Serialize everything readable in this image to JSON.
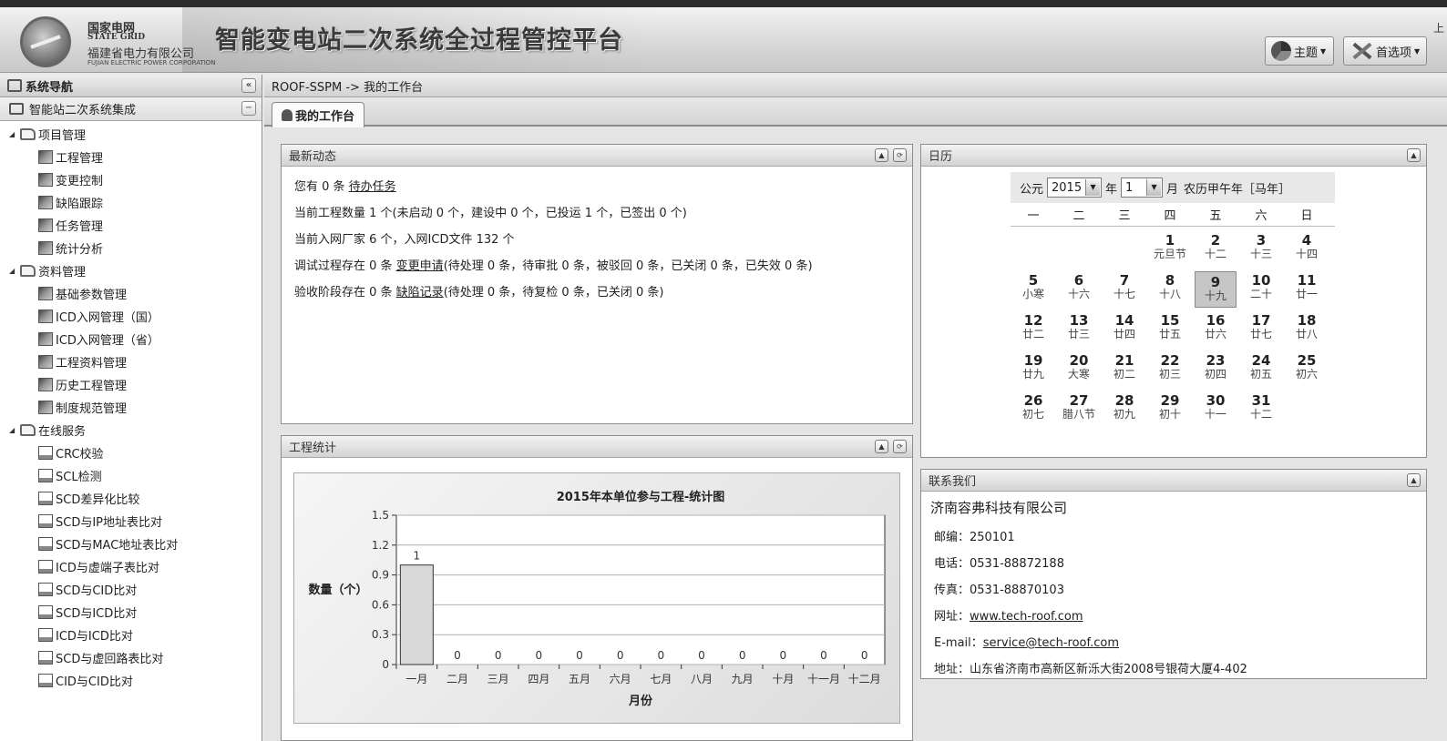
{
  "header": {
    "org_name": "国家电网",
    "org_name_en": "STATE GRID",
    "org_sub": "福建省电力有限公司",
    "org_sub_en": "FUJIAN ELECTRIC POWER CORPORATION",
    "app_title": "智能变电站二次系统全过程管控平台",
    "theme_label": "主题",
    "prefs_label": "首选项",
    "corner_text": "上"
  },
  "sidebar": {
    "title": "系统导航",
    "section": "智能站二次系统集成",
    "groups": [
      {
        "label": "项目管理",
        "items": [
          "工程管理",
          "变更控制",
          "缺陷跟踪",
          "任务管理",
          "统计分析"
        ]
      },
      {
        "label": "资料管理",
        "items": [
          "基础参数管理",
          "ICD入网管理（国）",
          "ICD入网管理（省）",
          "工程资料管理",
          "历史工程管理",
          "制度规范管理"
        ]
      },
      {
        "label": "在线服务",
        "items": [
          "CRC校验",
          "SCL检测",
          "SCD差异化比较",
          "SCD与IP地址表比对",
          "SCD与MAC地址表比对",
          "ICD与虚端子表比对",
          "SCD与CID比对",
          "SCD与ICD比对",
          "ICD与ICD比对",
          "SCD与虚回路表比对",
          "CID与CID比对"
        ]
      }
    ]
  },
  "main": {
    "breadcrumb": "ROOF-SSPM -> 我的工作台",
    "tab_label": "我的工作台"
  },
  "news": {
    "title": "最新动态",
    "line1": {
      "pre": "您有 0 条 ",
      "link": "待办任务",
      "post": ""
    },
    "line2": "当前工程数量 1 个(未启动 0 个，建设中 0 个，已投运 1 个，已签出 0 个)",
    "line3": "当前入网厂家 6 个，入网ICD文件 132 个",
    "line4": {
      "pre": "调试过程存在 0 条 ",
      "link": "变更申请",
      "post": "(待处理 0 条，待审批 0 条，被驳回 0 条，已关闭 0 条，已失效 0 条)"
    },
    "line5": {
      "pre": "验收阶段存在 0 条 ",
      "link": "缺陷记录",
      "post": "(待处理 0 条，待复检 0 条，已关闭 0 条)"
    }
  },
  "stats": {
    "title": "工程统计"
  },
  "chart_data": {
    "type": "bar",
    "title": "2015年本单位参与工程-统计图",
    "xlabel": "月份",
    "ylabel": "数量（个）",
    "categories": [
      "一月",
      "二月",
      "三月",
      "四月",
      "五月",
      "六月",
      "七月",
      "八月",
      "九月",
      "十月",
      "十一月",
      "十二月"
    ],
    "values": [
      1,
      0,
      0,
      0,
      0,
      0,
      0,
      0,
      0,
      0,
      0,
      0
    ],
    "ylim": [
      0,
      1.5
    ],
    "yticks": [
      "0",
      "0.3",
      "0.6",
      "0.9",
      "1.2",
      "1.5"
    ],
    "grid": true,
    "data_labels": true
  },
  "calendar": {
    "title": "日历",
    "era_label": "公元",
    "year": "2015",
    "year_unit": "年",
    "month": "1",
    "month_unit": "月",
    "lunar_label": "农历甲午年［马年］",
    "weekdays": [
      "一",
      "二",
      "三",
      "四",
      "五",
      "六",
      "日"
    ],
    "start_offset": 3,
    "today": 9,
    "days": [
      {
        "d": "1",
        "l": "元旦节"
      },
      {
        "d": "2",
        "l": "十二"
      },
      {
        "d": "3",
        "l": "十三"
      },
      {
        "d": "4",
        "l": "十四"
      },
      {
        "d": "5",
        "l": "小寒"
      },
      {
        "d": "6",
        "l": "十六"
      },
      {
        "d": "7",
        "l": "十七"
      },
      {
        "d": "8",
        "l": "十八"
      },
      {
        "d": "9",
        "l": "十九"
      },
      {
        "d": "10",
        "l": "二十"
      },
      {
        "d": "11",
        "l": "廿一"
      },
      {
        "d": "12",
        "l": "廿二"
      },
      {
        "d": "13",
        "l": "廿三"
      },
      {
        "d": "14",
        "l": "廿四"
      },
      {
        "d": "15",
        "l": "廿五"
      },
      {
        "d": "16",
        "l": "廿六"
      },
      {
        "d": "17",
        "l": "廿七"
      },
      {
        "d": "18",
        "l": "廿八"
      },
      {
        "d": "19",
        "l": "廿九"
      },
      {
        "d": "20",
        "l": "大寒"
      },
      {
        "d": "21",
        "l": "初二"
      },
      {
        "d": "22",
        "l": "初三"
      },
      {
        "d": "23",
        "l": "初四"
      },
      {
        "d": "24",
        "l": "初五"
      },
      {
        "d": "25",
        "l": "初六"
      },
      {
        "d": "26",
        "l": "初七"
      },
      {
        "d": "27",
        "l": "腊八节"
      },
      {
        "d": "28",
        "l": "初九"
      },
      {
        "d": "29",
        "l": "初十"
      },
      {
        "d": "30",
        "l": "十一"
      },
      {
        "d": "31",
        "l": "十二"
      }
    ]
  },
  "contact": {
    "title": "联系我们",
    "company": "济南容弗科技有限公司",
    "zip_label": "邮编：",
    "zip": "250101",
    "phone_label": "电话：",
    "phone": "0531-88872188",
    "fax_label": "传真：",
    "fax": "0531-88870103",
    "web_label": "网址：",
    "web": "www.tech-roof.com",
    "email_label": "E-mail：",
    "email": "service@tech-roof.com",
    "addr_label": "地址：",
    "addr": "山东省济南市高新区新泺大街2008号银荷大厦4-402"
  },
  "colors": {
    "today_bg": "#c6c6c6",
    "bar_fill": "#d9d9d9",
    "panel_head": "#d3d3d3"
  }
}
